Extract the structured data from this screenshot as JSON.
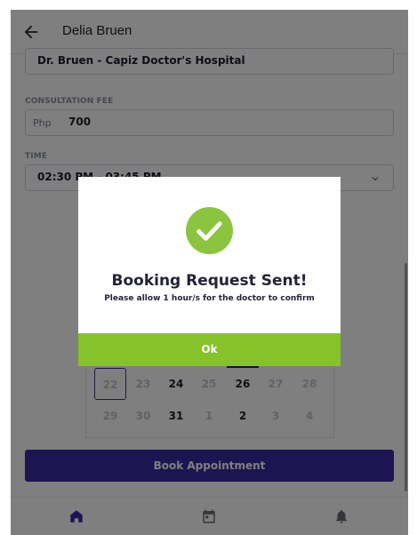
{
  "header": {
    "title": "Delia Bruen"
  },
  "form": {
    "clinic_value": "Dr. Bruen - Capiz Doctor's Hospital",
    "fee_label": "CONSULTATION FEE",
    "fee_prefix": "Php",
    "fee_value": "700",
    "time_label": "TIME",
    "time_value": "02:30 PM - 03:45 PM"
  },
  "calendar": {
    "rows": [
      [
        "22",
        "23",
        "24",
        "25",
        "26",
        "27",
        "28"
      ],
      [
        "29",
        "30",
        "31",
        "1",
        "2",
        "3",
        "4"
      ]
    ]
  },
  "book_button_label": "Book Appointment",
  "modal": {
    "title": "Booking Request Sent!",
    "subtitle": "Please allow 1 hour/s for the doctor to confirm",
    "ok_label": "Ok"
  },
  "colors": {
    "primary": "#3a2aa3",
    "accent_green": "#86c22a",
    "check_green": "#8bc53f"
  }
}
